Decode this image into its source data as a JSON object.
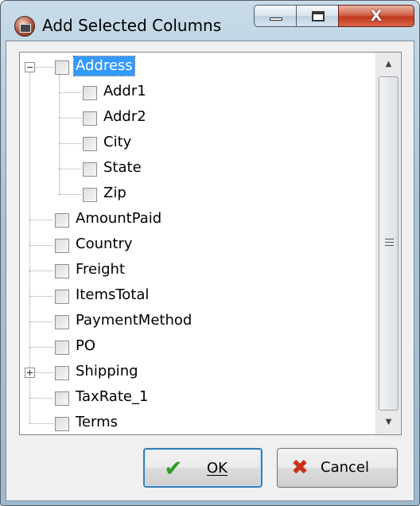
{
  "window": {
    "title": "Add Selected Columns",
    "app_icon": "app-icon",
    "caption_buttons": {
      "minimize_icon": "minimize-icon",
      "maximize_icon": "maximize-icon",
      "close_icon": "close-icon",
      "close_glyph": "X"
    }
  },
  "tree": {
    "items": [
      {
        "label": "Address",
        "expander": "minus",
        "selected": true,
        "checked": false,
        "children": [
          {
            "label": "Addr1",
            "checked": false
          },
          {
            "label": "Addr2",
            "checked": false
          },
          {
            "label": "City",
            "checked": false
          },
          {
            "label": "State",
            "checked": false
          },
          {
            "label": "Zip",
            "checked": false
          }
        ]
      },
      {
        "label": "AmountPaid",
        "checked": false
      },
      {
        "label": "Country",
        "checked": false
      },
      {
        "label": "Freight",
        "checked": false
      },
      {
        "label": "ItemsTotal",
        "checked": false
      },
      {
        "label": "PaymentMethod",
        "checked": false
      },
      {
        "label": "PO",
        "checked": false
      },
      {
        "label": "Shipping",
        "expander": "plus",
        "checked": false
      },
      {
        "label": "TaxRate_1",
        "checked": false
      },
      {
        "label": "Terms",
        "checked": false
      }
    ],
    "scrollbar": {
      "up_icon": "scroll-up-arrow-icon",
      "down_icon": "scroll-down-arrow-icon",
      "grip_icon": "scroll-grip-icon"
    }
  },
  "buttons": {
    "ok": {
      "label": "OK",
      "icon": "checkmark-icon",
      "glyph": "✔"
    },
    "cancel": {
      "label": "Cancel",
      "icon": "x-mark-icon",
      "glyph": "✖"
    }
  },
  "colors": {
    "selection": "#3399ff",
    "ok_icon": "#2f9b25",
    "cancel_icon": "#c8301c",
    "close_button": "#c1391b"
  }
}
